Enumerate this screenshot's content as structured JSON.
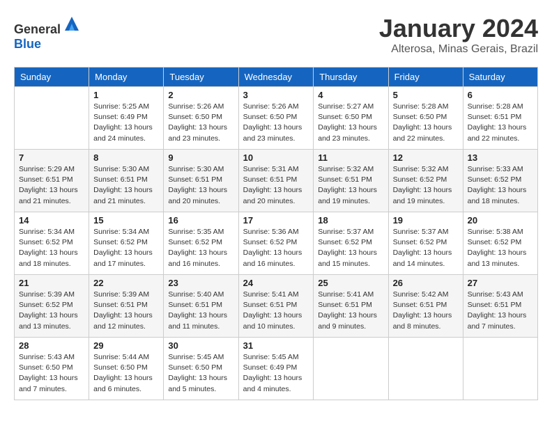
{
  "header": {
    "logo_general": "General",
    "logo_blue": "Blue",
    "month_year": "January 2024",
    "location": "Alterosa, Minas Gerais, Brazil"
  },
  "columns": [
    "Sunday",
    "Monday",
    "Tuesday",
    "Wednesday",
    "Thursday",
    "Friday",
    "Saturday"
  ],
  "weeks": [
    [
      {
        "day": "",
        "sunrise": "",
        "sunset": "",
        "daylight": ""
      },
      {
        "day": "1",
        "sunrise": "Sunrise: 5:25 AM",
        "sunset": "Sunset: 6:49 PM",
        "daylight": "Daylight: 13 hours and 24 minutes."
      },
      {
        "day": "2",
        "sunrise": "Sunrise: 5:26 AM",
        "sunset": "Sunset: 6:50 PM",
        "daylight": "Daylight: 13 hours and 23 minutes."
      },
      {
        "day": "3",
        "sunrise": "Sunrise: 5:26 AM",
        "sunset": "Sunset: 6:50 PM",
        "daylight": "Daylight: 13 hours and 23 minutes."
      },
      {
        "day": "4",
        "sunrise": "Sunrise: 5:27 AM",
        "sunset": "Sunset: 6:50 PM",
        "daylight": "Daylight: 13 hours and 23 minutes."
      },
      {
        "day": "5",
        "sunrise": "Sunrise: 5:28 AM",
        "sunset": "Sunset: 6:50 PM",
        "daylight": "Daylight: 13 hours and 22 minutes."
      },
      {
        "day": "6",
        "sunrise": "Sunrise: 5:28 AM",
        "sunset": "Sunset: 6:51 PM",
        "daylight": "Daylight: 13 hours and 22 minutes."
      }
    ],
    [
      {
        "day": "7",
        "sunrise": "Sunrise: 5:29 AM",
        "sunset": "Sunset: 6:51 PM",
        "daylight": "Daylight: 13 hours and 21 minutes."
      },
      {
        "day": "8",
        "sunrise": "Sunrise: 5:30 AM",
        "sunset": "Sunset: 6:51 PM",
        "daylight": "Daylight: 13 hours and 21 minutes."
      },
      {
        "day": "9",
        "sunrise": "Sunrise: 5:30 AM",
        "sunset": "Sunset: 6:51 PM",
        "daylight": "Daylight: 13 hours and 20 minutes."
      },
      {
        "day": "10",
        "sunrise": "Sunrise: 5:31 AM",
        "sunset": "Sunset: 6:51 PM",
        "daylight": "Daylight: 13 hours and 20 minutes."
      },
      {
        "day": "11",
        "sunrise": "Sunrise: 5:32 AM",
        "sunset": "Sunset: 6:51 PM",
        "daylight": "Daylight: 13 hours and 19 minutes."
      },
      {
        "day": "12",
        "sunrise": "Sunrise: 5:32 AM",
        "sunset": "Sunset: 6:52 PM",
        "daylight": "Daylight: 13 hours and 19 minutes."
      },
      {
        "day": "13",
        "sunrise": "Sunrise: 5:33 AM",
        "sunset": "Sunset: 6:52 PM",
        "daylight": "Daylight: 13 hours and 18 minutes."
      }
    ],
    [
      {
        "day": "14",
        "sunrise": "Sunrise: 5:34 AM",
        "sunset": "Sunset: 6:52 PM",
        "daylight": "Daylight: 13 hours and 18 minutes."
      },
      {
        "day": "15",
        "sunrise": "Sunrise: 5:34 AM",
        "sunset": "Sunset: 6:52 PM",
        "daylight": "Daylight: 13 hours and 17 minutes."
      },
      {
        "day": "16",
        "sunrise": "Sunrise: 5:35 AM",
        "sunset": "Sunset: 6:52 PM",
        "daylight": "Daylight: 13 hours and 16 minutes."
      },
      {
        "day": "17",
        "sunrise": "Sunrise: 5:36 AM",
        "sunset": "Sunset: 6:52 PM",
        "daylight": "Daylight: 13 hours and 16 minutes."
      },
      {
        "day": "18",
        "sunrise": "Sunrise: 5:37 AM",
        "sunset": "Sunset: 6:52 PM",
        "daylight": "Daylight: 13 hours and 15 minutes."
      },
      {
        "day": "19",
        "sunrise": "Sunrise: 5:37 AM",
        "sunset": "Sunset: 6:52 PM",
        "daylight": "Daylight: 13 hours and 14 minutes."
      },
      {
        "day": "20",
        "sunrise": "Sunrise: 5:38 AM",
        "sunset": "Sunset: 6:52 PM",
        "daylight": "Daylight: 13 hours and 13 minutes."
      }
    ],
    [
      {
        "day": "21",
        "sunrise": "Sunrise: 5:39 AM",
        "sunset": "Sunset: 6:52 PM",
        "daylight": "Daylight: 13 hours and 13 minutes."
      },
      {
        "day": "22",
        "sunrise": "Sunrise: 5:39 AM",
        "sunset": "Sunset: 6:51 PM",
        "daylight": "Daylight: 13 hours and 12 minutes."
      },
      {
        "day": "23",
        "sunrise": "Sunrise: 5:40 AM",
        "sunset": "Sunset: 6:51 PM",
        "daylight": "Daylight: 13 hours and 11 minutes."
      },
      {
        "day": "24",
        "sunrise": "Sunrise: 5:41 AM",
        "sunset": "Sunset: 6:51 PM",
        "daylight": "Daylight: 13 hours and 10 minutes."
      },
      {
        "day": "25",
        "sunrise": "Sunrise: 5:41 AM",
        "sunset": "Sunset: 6:51 PM",
        "daylight": "Daylight: 13 hours and 9 minutes."
      },
      {
        "day": "26",
        "sunrise": "Sunrise: 5:42 AM",
        "sunset": "Sunset: 6:51 PM",
        "daylight": "Daylight: 13 hours and 8 minutes."
      },
      {
        "day": "27",
        "sunrise": "Sunrise: 5:43 AM",
        "sunset": "Sunset: 6:51 PM",
        "daylight": "Daylight: 13 hours and 7 minutes."
      }
    ],
    [
      {
        "day": "28",
        "sunrise": "Sunrise: 5:43 AM",
        "sunset": "Sunset: 6:50 PM",
        "daylight": "Daylight: 13 hours and 7 minutes."
      },
      {
        "day": "29",
        "sunrise": "Sunrise: 5:44 AM",
        "sunset": "Sunset: 6:50 PM",
        "daylight": "Daylight: 13 hours and 6 minutes."
      },
      {
        "day": "30",
        "sunrise": "Sunrise: 5:45 AM",
        "sunset": "Sunset: 6:50 PM",
        "daylight": "Daylight: 13 hours and 5 minutes."
      },
      {
        "day": "31",
        "sunrise": "Sunrise: 5:45 AM",
        "sunset": "Sunset: 6:49 PM",
        "daylight": "Daylight: 13 hours and 4 minutes."
      },
      {
        "day": "",
        "sunrise": "",
        "sunset": "",
        "daylight": ""
      },
      {
        "day": "",
        "sunrise": "",
        "sunset": "",
        "daylight": ""
      },
      {
        "day": "",
        "sunrise": "",
        "sunset": "",
        "daylight": ""
      }
    ]
  ]
}
